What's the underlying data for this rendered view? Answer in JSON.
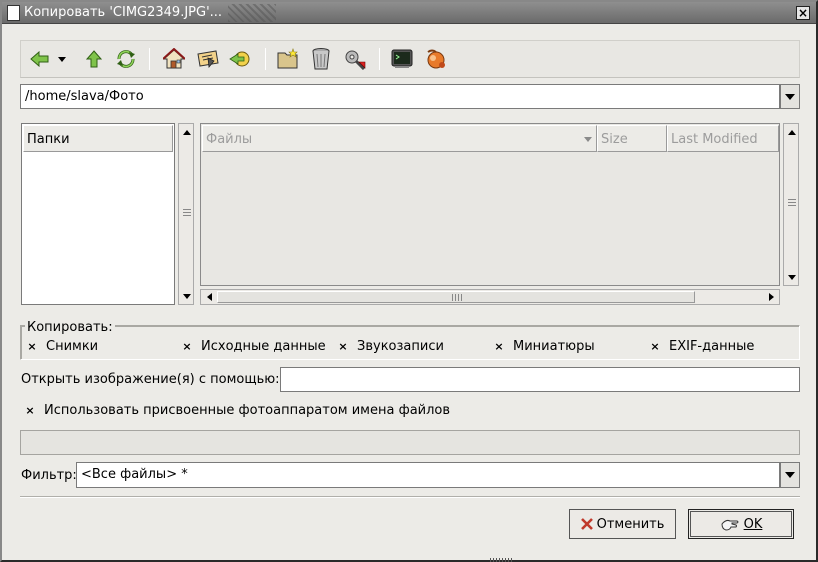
{
  "window": {
    "title": "Копировать 'CIMG2349.JPG'...",
    "close_glyph": "×"
  },
  "toolbar": {
    "buttons": [
      {
        "name": "back-icon"
      },
      {
        "name": "history-dropdown-icon"
      },
      {
        "name": "up-icon"
      },
      {
        "name": "reload-icon"
      },
      {
        "name": "home-icon"
      },
      {
        "name": "bookmark-icon"
      },
      {
        "name": "go-icon"
      },
      {
        "name": "new-folder-icon"
      },
      {
        "name": "trash-icon"
      },
      {
        "name": "properties-icon"
      },
      {
        "name": "terminal-icon"
      },
      {
        "name": "preview-icon"
      }
    ]
  },
  "location": {
    "path": "/home/slava/Фото"
  },
  "folders_panel": {
    "header": "Папки"
  },
  "files_panel": {
    "columns": [
      "Файлы",
      "Size",
      "Last Modified"
    ]
  },
  "copy_section": {
    "label": "Копировать:",
    "options": [
      {
        "label": "Снимки",
        "checked": true
      },
      {
        "label": "Исходные данные",
        "checked": true
      },
      {
        "label": "Звукозаписи",
        "checked": true
      },
      {
        "label": "Миниатюры",
        "checked": true
      },
      {
        "label": "EXIF-данные",
        "checked": true
      }
    ]
  },
  "open_with": {
    "label": "Открыть изображение(я) с помощью:",
    "value": ""
  },
  "use_camera_names": {
    "label": "Использовать присвоенные фотоаппаратом имена файлов",
    "checked": true
  },
  "filter": {
    "label": "Фильтр:",
    "value": "<Все файлы> *"
  },
  "buttons": {
    "cancel": "Отменить",
    "ok": "OK"
  },
  "checkmark": "×",
  "colors": {
    "window_bg": "#ecebe7",
    "titlebar": "#7a7a7a",
    "cancel_icon": "#c0392b"
  }
}
